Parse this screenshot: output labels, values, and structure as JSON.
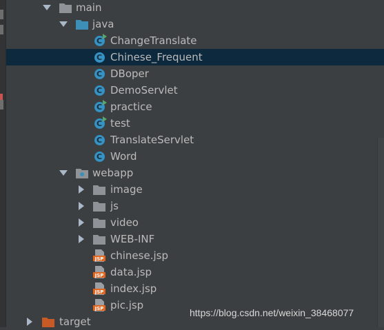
{
  "tree": {
    "main": {
      "label": "main",
      "icon": "folder-icon"
    },
    "java": {
      "label": "java",
      "icon": "source-folder-icon"
    },
    "classes": [
      {
        "label": "ChangeTranslate",
        "icon": "java-class-runnable-icon",
        "badge": "C"
      },
      {
        "label": "Chinese_Frequent",
        "icon": "java-class-icon",
        "badge": "C",
        "selected": true
      },
      {
        "label": "DBoper",
        "icon": "java-class-icon",
        "badge": "C"
      },
      {
        "label": "DemoServlet",
        "icon": "java-class-icon",
        "badge": "C"
      },
      {
        "label": "practice",
        "icon": "java-class-runnable-icon",
        "badge": "C"
      },
      {
        "label": "test",
        "icon": "java-class-runnable-icon",
        "badge": "C"
      },
      {
        "label": "TranslateServlet",
        "icon": "java-class-icon",
        "badge": "C"
      },
      {
        "label": "Word",
        "icon": "java-class-icon",
        "badge": "C"
      }
    ],
    "webapp": {
      "label": "webapp",
      "icon": "web-folder-icon"
    },
    "folders": [
      {
        "label": "image"
      },
      {
        "label": "js"
      },
      {
        "label": "video"
      },
      {
        "label": "WEB-INF"
      }
    ],
    "jsp_files": [
      {
        "label": "chinese.jsp",
        "icon_text": "JSP"
      },
      {
        "label": "data.jsp",
        "icon_text": "JSP"
      },
      {
        "label": "index.jsp",
        "icon_text": "JSP"
      },
      {
        "label": "pic.jsp",
        "icon_text": "JSP"
      }
    ],
    "target": {
      "label": "target",
      "icon": "excluded-folder-icon"
    }
  },
  "watermark": "https://blog.csdn.net/weixin_38468077",
  "colors": {
    "background": "#3c3f41",
    "selection": "#0d293e",
    "text": "#bbbbbb",
    "class_badge": "#3592c4",
    "folder": "#8f9398",
    "source_folder": "#3d8fb8",
    "excluded_folder": "#c85a25",
    "jsp_badge": "#e2641d",
    "run_marker": "#59a869"
  }
}
